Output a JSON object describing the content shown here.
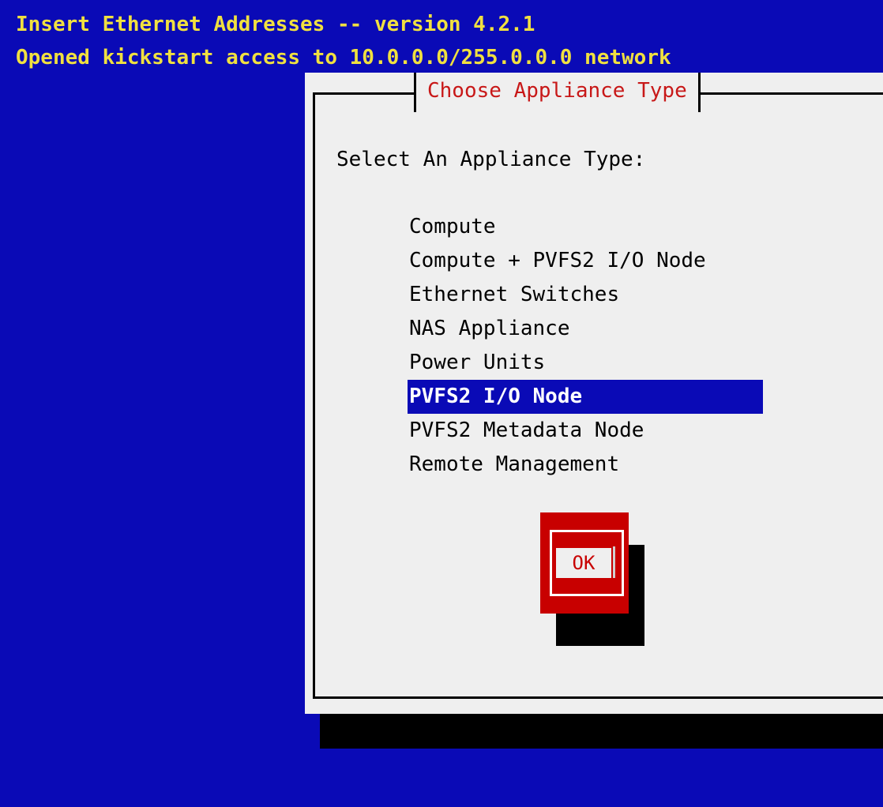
{
  "header": {
    "line1": "Insert Ethernet Addresses -- version 4.2.1",
    "line2": "Opened kickstart access to 10.0.0.0/255.0.0.0 network"
  },
  "dialog": {
    "title": "Choose Appliance Type",
    "prompt": "Select An Appliance Type:",
    "items": [
      {
        "label": "Compute",
        "selected": false
      },
      {
        "label": "Compute + PVFS2 I/O Node",
        "selected": false
      },
      {
        "label": "Ethernet Switches",
        "selected": false
      },
      {
        "label": "NAS Appliance",
        "selected": false
      },
      {
        "label": "Power Units",
        "selected": false
      },
      {
        "label": "PVFS2 I/O Node",
        "selected": true
      },
      {
        "label": "PVFS2 Metadata Node",
        "selected": false
      },
      {
        "label": "Remote Management",
        "selected": false
      }
    ],
    "ok_label": "OK"
  },
  "colors": {
    "background": "#0a0ab6",
    "header_text": "#f0e040",
    "dialog_bg": "#efefef",
    "title_text": "#c81818",
    "selection_bg": "#0a0ab6",
    "button_bg": "#c80000"
  }
}
